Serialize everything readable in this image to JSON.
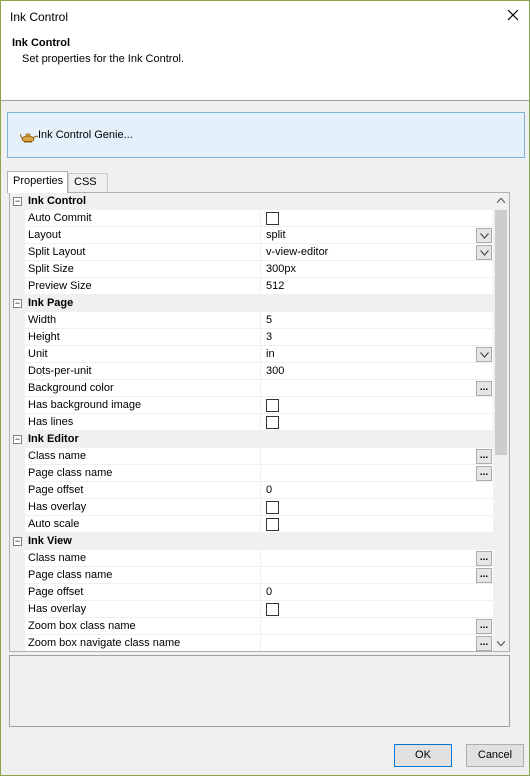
{
  "window": {
    "title": "Ink Control"
  },
  "header": {
    "title": "Ink Control",
    "subtitle": "Set properties for the Ink Control."
  },
  "genie": {
    "label": "Ink Control Genie..."
  },
  "tabs": [
    {
      "label": "Properties",
      "active": true
    },
    {
      "label": "CSS",
      "active": false
    }
  ],
  "categories": [
    {
      "name": "Ink Control",
      "expander": "−",
      "properties": [
        {
          "name": "Auto Commit",
          "type": "checkbox",
          "value": ""
        },
        {
          "name": "Layout",
          "type": "dropdown",
          "value": "split"
        },
        {
          "name": "Split Layout",
          "type": "dropdown",
          "value": "v-view-editor"
        },
        {
          "name": "Split Size",
          "type": "text",
          "value": "300px"
        },
        {
          "name": "Preview Size",
          "type": "text",
          "value": "512"
        }
      ]
    },
    {
      "name": "Ink Page",
      "expander": "−",
      "properties": [
        {
          "name": "Width",
          "type": "text",
          "value": "5"
        },
        {
          "name": "Height",
          "type": "text",
          "value": "3"
        },
        {
          "name": "Unit",
          "type": "dropdown",
          "value": "in"
        },
        {
          "name": "Dots-per-unit",
          "type": "text",
          "value": "300"
        },
        {
          "name": "Background color",
          "type": "ellipsis",
          "value": ""
        },
        {
          "name": "Has background image",
          "type": "checkbox",
          "value": ""
        },
        {
          "name": "Has lines",
          "type": "checkbox",
          "value": ""
        }
      ]
    },
    {
      "name": "Ink Editor",
      "expander": "−",
      "properties": [
        {
          "name": "Class name",
          "type": "ellipsis",
          "value": ""
        },
        {
          "name": "Page class name",
          "type": "ellipsis",
          "value": ""
        },
        {
          "name": "Page offset",
          "type": "text",
          "value": "0"
        },
        {
          "name": "Has overlay",
          "type": "checkbox",
          "value": ""
        },
        {
          "name": "Auto scale",
          "type": "checkbox",
          "value": ""
        }
      ]
    },
    {
      "name": "Ink View",
      "expander": "−",
      "properties": [
        {
          "name": "Class name",
          "type": "ellipsis",
          "value": ""
        },
        {
          "name": "Page class name",
          "type": "ellipsis",
          "value": ""
        },
        {
          "name": "Page offset",
          "type": "text",
          "value": "0"
        },
        {
          "name": "Has overlay",
          "type": "checkbox",
          "value": ""
        },
        {
          "name": "Zoom box class name",
          "type": "ellipsis",
          "value": ""
        },
        {
          "name": "Zoom box navigate class name",
          "type": "ellipsis",
          "value": ""
        }
      ]
    }
  ],
  "buttons": {
    "ok": "OK",
    "cancel": "Cancel"
  },
  "icons": {
    "close": "close-icon",
    "genie": "genie-lamp-icon",
    "dropdown": "chevron-down-icon",
    "ellipsis": "..."
  }
}
